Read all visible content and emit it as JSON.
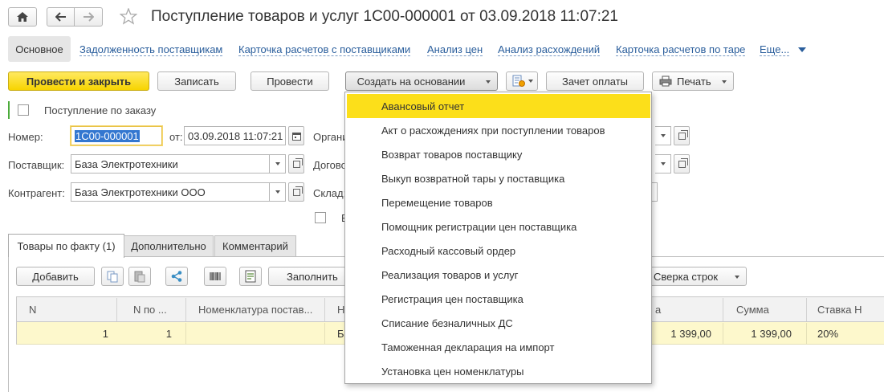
{
  "window": {
    "title": "Поступление товаров и услуг 1С00-000001 от 03.09.2018 11:07:21"
  },
  "nav_tabs": [
    {
      "label": "Основное"
    },
    {
      "label": "Задолженность поставщикам"
    },
    {
      "label": "Карточка расчетов с поставщиками"
    },
    {
      "label": "Анализ цен"
    },
    {
      "label": "Анализ расхождений"
    },
    {
      "label": "Карточка расчетов по таре"
    },
    {
      "label": "Еще..."
    }
  ],
  "toolbar": {
    "post_close": "Провести и закрыть",
    "save": "Записать",
    "post": "Провести",
    "create_based_on": "Создать на основании",
    "payment_offset": "Зачет оплаты",
    "print": "Печать"
  },
  "form": {
    "by_order_label": "Поступление по заказу",
    "number_label": "Номер:",
    "number_value": "1С00-000001",
    "date_label": "от:",
    "date_value": "03.09.2018 11:07:21",
    "supplier_label": "Поставщик:",
    "supplier_value": "База Электротехники",
    "counterparty_label": "Контрагент:",
    "counterparty_value": "База Электротехники ООО",
    "organization_label": "Органи",
    "contract_label": "Догово",
    "warehouse_label": "Склад:",
    "hidden_checkbox_label": "В"
  },
  "table_tabs": [
    {
      "label": "Товары по факту (1)"
    },
    {
      "label": "Дополнительно"
    },
    {
      "label": "Комментарий"
    }
  ],
  "table_toolbar": {
    "add": "Добавить",
    "fill": "Заполнить",
    "reconcile": "Сверка строк"
  },
  "table": {
    "columns": [
      "N",
      "N по ...",
      "Номенклатура постав...",
      "Н",
      "а",
      "Сумма",
      "Ставка Н"
    ],
    "rows": [
      {
        "n": "1",
        "n_po": "1",
        "nomenclature_supplier": "",
        "nomenclature": "Б",
        "price": "1 399,00",
        "sum": "1 399,00",
        "vat": "20%"
      }
    ]
  },
  "dropdown_menu": {
    "items": [
      {
        "label": "Авансовый отчет",
        "selected": true
      },
      {
        "label": "Акт о расхождениях при поступлении товаров"
      },
      {
        "label": "Возврат товаров поставщику"
      },
      {
        "label": "Выкуп возвратной тары у поставщика"
      },
      {
        "label": "Перемещение товаров"
      },
      {
        "label": "Помощник регистрации цен поставщика"
      },
      {
        "label": "Расходный кассовый ордер"
      },
      {
        "label": "Реализация товаров и услуг"
      },
      {
        "label": "Регистрация цен поставщика"
      },
      {
        "label": "Списание безналичных ДС"
      },
      {
        "label": "Таможенная декларация на импорт"
      },
      {
        "label": "Установка цен номенклатуры"
      }
    ]
  },
  "colors": {
    "accent_yellow": "#fcdf1a",
    "link_blue": "#2a5e9c",
    "row_highlight": "#fdf8cc"
  }
}
